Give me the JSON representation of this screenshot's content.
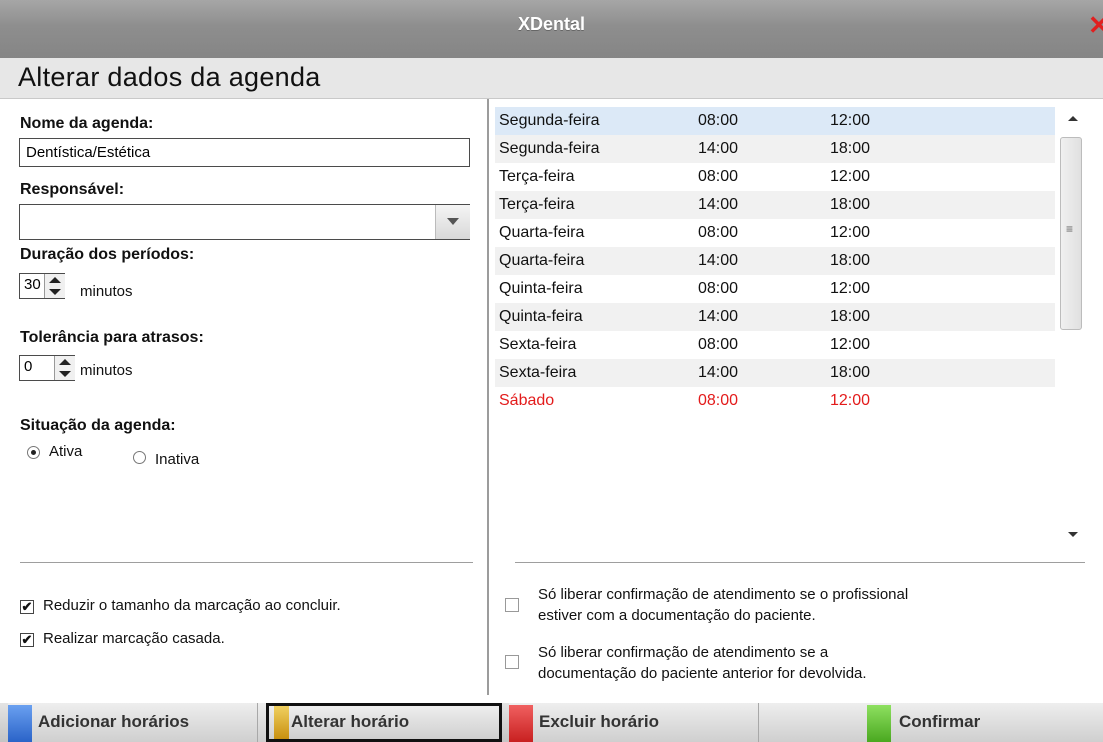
{
  "window": {
    "title": "XDental",
    "close_glyph": "✕"
  },
  "page": {
    "heading": "Alterar dados da agenda"
  },
  "form": {
    "nome_label": "Nome da agenda:",
    "nome_value": "Dentística/Estética",
    "responsavel_label": "Responsável:",
    "responsavel_value": "",
    "duracao_label": "Duração dos períodos:",
    "duracao_value": "30",
    "duracao_unit": "minutos",
    "tolerancia_label": "Tolerância para atrasos:",
    "tolerancia_value": "0",
    "tolerancia_unit": "minutos",
    "situacao_label": "Situação da agenda:",
    "situacao_options": [
      "Ativa",
      "Inativa"
    ],
    "situacao_selected": "Ativa"
  },
  "options_left": {
    "reduzir": {
      "label": "Reduzir o tamanho da marcação ao concluir.",
      "checked": true
    },
    "casada": {
      "label": "Realizar marcação casada.",
      "checked": true
    }
  },
  "schedule": [
    {
      "day": "Segunda-feira",
      "start": "08:00",
      "end": "12:00",
      "selected": true
    },
    {
      "day": "Segunda-feira",
      "start": "14:00",
      "end": "18:00"
    },
    {
      "day": "Terça-feira",
      "start": "08:00",
      "end": "12:00"
    },
    {
      "day": "Terça-feira",
      "start": "14:00",
      "end": "18:00"
    },
    {
      "day": "Quarta-feira",
      "start": "08:00",
      "end": "12:00"
    },
    {
      "day": "Quarta-feira",
      "start": "14:00",
      "end": "18:00"
    },
    {
      "day": "Quinta-feira",
      "start": "08:00",
      "end": "12:00"
    },
    {
      "day": "Quinta-feira",
      "start": "14:00",
      "end": "18:00"
    },
    {
      "day": "Sexta-feira",
      "start": "08:00",
      "end": "12:00"
    },
    {
      "day": "Sexta-feira",
      "start": "14:00",
      "end": "18:00"
    },
    {
      "day": "Sábado",
      "start": "08:00",
      "end": "12:00",
      "highlight": "#e31b1b"
    }
  ],
  "options_right": {
    "opt1": {
      "line1": "Só liberar confirmação de atendimento se o profissional",
      "line2": "estiver com a documentação do paciente.",
      "checked": false
    },
    "opt2": {
      "line1": "Só liberar confirmação de atendimento se a",
      "line2": "documentação do paciente anterior for devolvida.",
      "checked": false
    }
  },
  "buttons": {
    "adicionar": {
      "label": "Adicionar horários",
      "color": "#3b78d8"
    },
    "alterar": {
      "label": "Alterar horário",
      "color": "#e0b020"
    },
    "excluir": {
      "label": "Excluir horário",
      "color": "#d83030"
    },
    "confirmar": {
      "label": "Confirmar",
      "color": "#5cc030"
    }
  }
}
